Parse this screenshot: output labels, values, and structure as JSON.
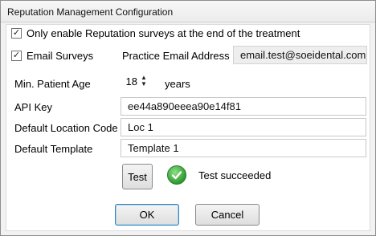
{
  "window": {
    "title": "Reputation Management Configuration"
  },
  "options": {
    "end_of_treatment": {
      "label": "Only enable Reputation surveys at the end of the treatment",
      "checked": true
    },
    "email_surveys": {
      "label": "Email Surveys",
      "checked": true
    }
  },
  "practice_email": {
    "label": "Practice Email Address",
    "value": "email.test@soeidental.com"
  },
  "min_age": {
    "label": "Min. Patient Age",
    "value": "18",
    "unit": "years"
  },
  "api_key": {
    "label": "API Key",
    "value": "ee44a890eeea90e14f81"
  },
  "location_code": {
    "label": "Default Location Code",
    "value": "Loc 1"
  },
  "template": {
    "label": "Default Template",
    "value": "Template 1"
  },
  "test": {
    "button": "Test",
    "status": "Test succeeded",
    "status_icon": "check-circle-icon",
    "status_color": "#2e9a2e"
  },
  "footer": {
    "ok": "OK",
    "cancel": "Cancel"
  },
  "check_glyph": "✓"
}
